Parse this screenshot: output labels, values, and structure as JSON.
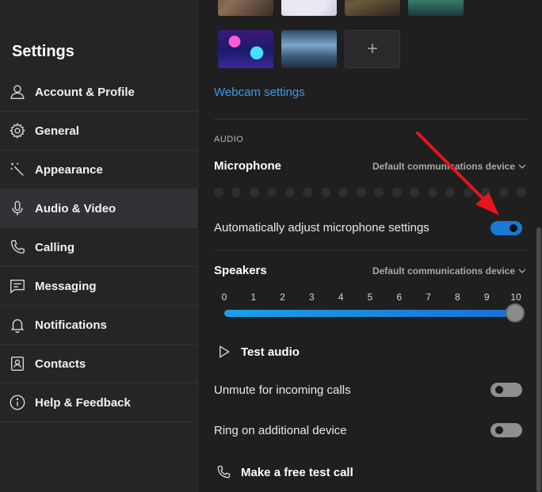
{
  "sidebar": {
    "title": "Settings",
    "items": [
      {
        "label": "Account & Profile",
        "icon": "person-icon"
      },
      {
        "label": "General",
        "icon": "gear-icon"
      },
      {
        "label": "Appearance",
        "icon": "magic-wand-icon"
      },
      {
        "label": "Audio & Video",
        "icon": "microphone-icon",
        "active": true
      },
      {
        "label": "Calling",
        "icon": "phone-icon"
      },
      {
        "label": "Messaging",
        "icon": "chat-icon"
      },
      {
        "label": "Notifications",
        "icon": "bell-icon"
      },
      {
        "label": "Contacts",
        "icon": "contact-card-icon"
      },
      {
        "label": "Help & Feedback",
        "icon": "info-icon"
      }
    ]
  },
  "video": {
    "add_background_label": "+",
    "webcam_settings_link": "Webcam settings"
  },
  "audio": {
    "section_label": "AUDIO",
    "microphone": {
      "title": "Microphone",
      "device": "Default communications device",
      "level_dots": 18
    },
    "auto_adjust": {
      "label": "Automatically adjust microphone settings",
      "enabled": true
    },
    "speakers": {
      "title": "Speakers",
      "device": "Default communications device",
      "volume_ticks": [
        "0",
        "1",
        "2",
        "3",
        "4",
        "5",
        "6",
        "7",
        "8",
        "9",
        "10"
      ],
      "volume": 10
    },
    "test_audio_label": "Test audio",
    "unmute_incoming": {
      "label": "Unmute for incoming calls",
      "enabled": false
    },
    "ring_additional": {
      "label": "Ring on additional device",
      "enabled": false
    },
    "free_test_call_label": "Make a free test call"
  },
  "colors": {
    "accent": "#1a78d6",
    "link": "#3d9ae8",
    "annotation_arrow": "#e8141b"
  }
}
